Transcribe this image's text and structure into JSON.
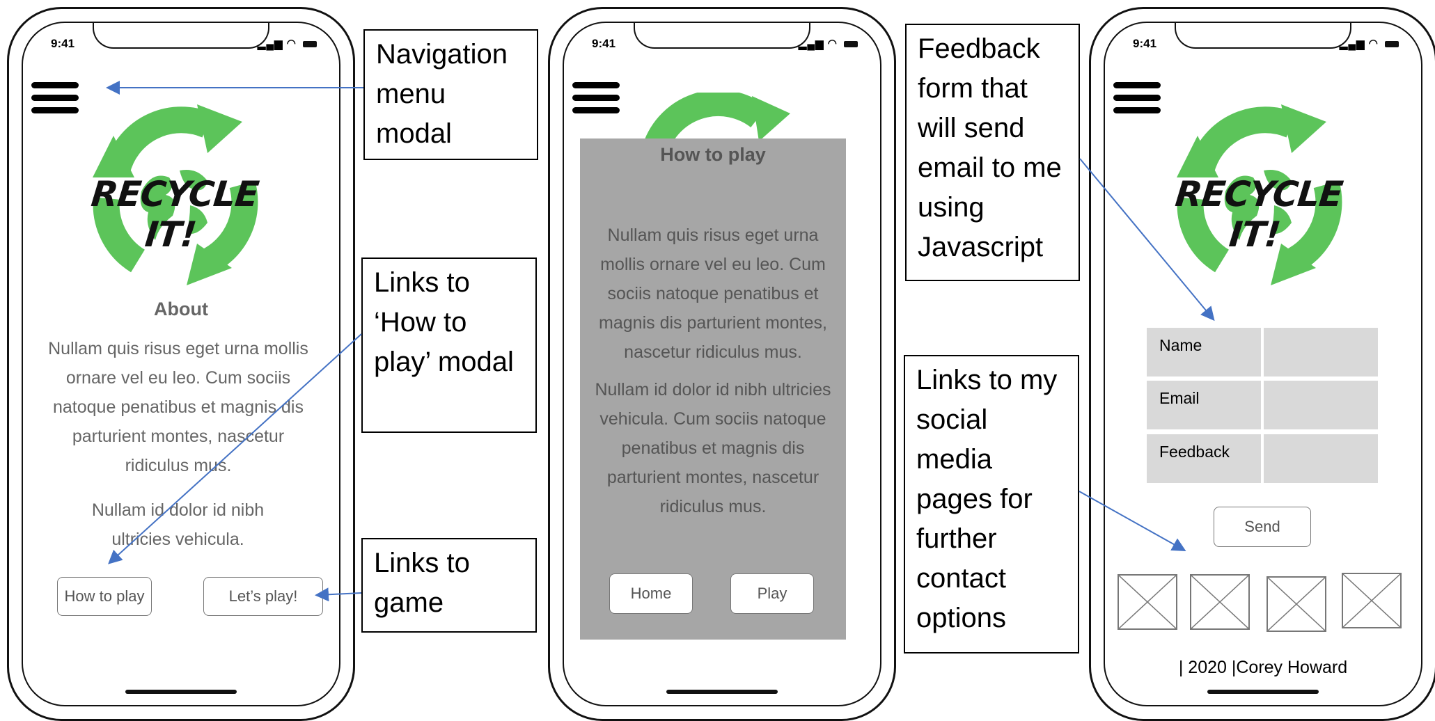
{
  "status": {
    "time": "9:41"
  },
  "screen1": {
    "logo_text": "RECYCLE IT!",
    "about_title": "About",
    "paragraph1": "Nullam quis risus eget urna mollis ornare vel eu leo. Cum sociis natoque penatibus et magnis dis parturient montes, nascetur ridiculus mus.",
    "paragraph2": "Nullam id dolor id nibh ultricies vehicula.",
    "how_to_play_button": "How to play",
    "lets_play_button": "Let’s play!"
  },
  "screen2": {
    "modal_title": "How to play",
    "paragraph1": "Nullam quis risus eget urna mollis ornare vel eu leo. Cum sociis natoque penatibus et magnis dis parturient montes, nascetur ridiculus mus.",
    "paragraph2": "Nullam id dolor id nibh ultricies vehicula. Cum sociis natoque penatibus et magnis dis parturient montes, nascetur ridiculus mus.",
    "home_button": "Home",
    "play_button": "Play"
  },
  "screen3": {
    "logo_text": "RECYCLE IT!",
    "form": {
      "name_label": "Name",
      "email_label": "Email",
      "feedback_label": "Feedback"
    },
    "send_button": "Send",
    "social_icons": [
      "image-placeholder-icon",
      "image-placeholder-icon",
      "image-placeholder-icon",
      "image-placeholder-icon"
    ],
    "footer": "| 2020 |Corey Howard"
  },
  "callouts": {
    "navigation": "Navigation menu modal",
    "how_to_play_links": "Links to ‘How to play’ modal",
    "game_links": "Links to game",
    "feedback_form": "Feedback form that will send email to me using Javascript",
    "social_links": "Links to my social media pages for further contact options"
  },
  "colors": {
    "logo_green": "#5cc45a",
    "modal_gray": "#a6a6a6",
    "text_gray": "#666666",
    "form_gray": "#d9d9d9",
    "arrow_blue": "#4472c4"
  }
}
